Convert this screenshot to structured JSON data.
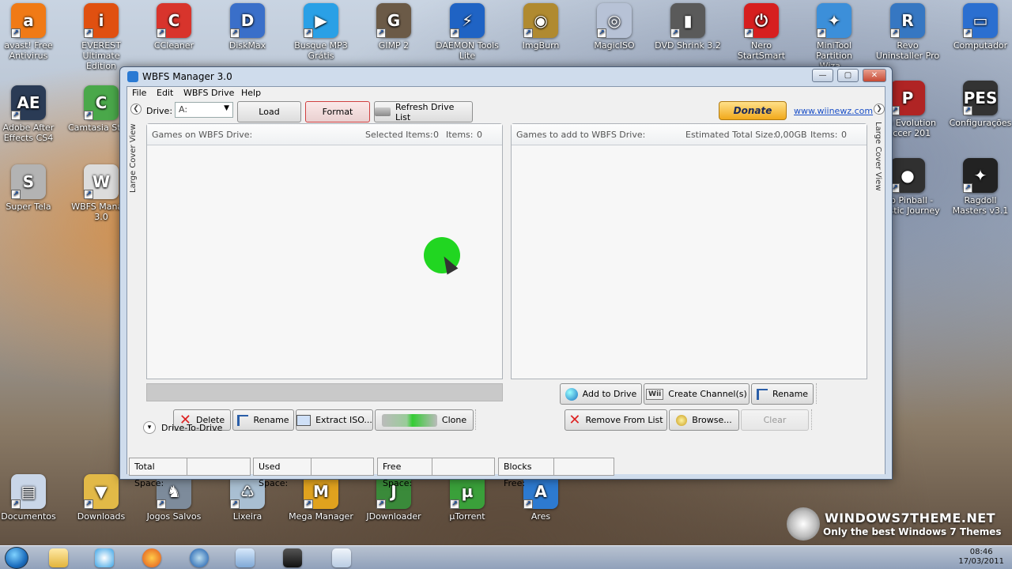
{
  "desktop": {
    "top_icons": [
      {
        "label": "avast! Free Antivirus",
        "color": "#f07a16",
        "glyph": "a"
      },
      {
        "label": "EVEREST Ultimate Edition",
        "color": "#e05010",
        "glyph": "i"
      },
      {
        "label": "CCleaner",
        "color": "#d8342c",
        "glyph": "C"
      },
      {
        "label": "DiskMax",
        "color": "#3a6fc9",
        "glyph": "D"
      },
      {
        "label": "Busque MP3 Grátis",
        "color": "#2aa0e6",
        "glyph": "▶"
      },
      {
        "label": "GIMP 2",
        "color": "#6b5a47",
        "glyph": "G"
      },
      {
        "label": "DAEMON Tools Lite",
        "color": "#1f63c4",
        "glyph": "⚡"
      },
      {
        "label": "ImgBurn",
        "color": "#b08a30",
        "glyph": "◉"
      },
      {
        "label": "MagicISO",
        "color": "#b7c2d6",
        "glyph": "◎"
      },
      {
        "label": "DVD Shrink 3.2",
        "color": "#5a5a5a",
        "glyph": "▮"
      },
      {
        "label": "Nero StartSmart",
        "color": "#d61f1f",
        "glyph": "⏻"
      },
      {
        "label": "MiniTool Partition Wiza...",
        "color": "#3c8fd9",
        "glyph": "✦"
      },
      {
        "label": "Revo Uninstaller Pro",
        "color": "#3677c2",
        "glyph": "R"
      },
      {
        "label": "Computador",
        "color": "#2b6fd0",
        "glyph": "▭"
      }
    ],
    "left_icons": [
      {
        "label": "Adobe After Effects CS4",
        "color": "#2a3b55",
        "glyph": "AE"
      },
      {
        "label": "Camtasia Stu...",
        "color": "#4aa84a",
        "glyph": "C"
      },
      {
        "label": "Super Tela",
        "color": "#b3b3b3",
        "glyph": "S"
      },
      {
        "label": "WBFS Mana... 3.0",
        "color": "#dcdcdc",
        "glyph": "W"
      }
    ],
    "right_icons": [
      {
        "label": "...o Evolution ...ccer 201",
        "color": "#b02424",
        "glyph": "P"
      },
      {
        "label": "Configurações",
        "color": "#333333",
        "glyph": "PES"
      },
      {
        "label": "...o Pinball - ...astic Journey",
        "color": "#303030",
        "glyph": "●"
      },
      {
        "label": "Ragdoll Masters v3.1",
        "color": "#222222",
        "glyph": "✦"
      }
    ],
    "bottom_icons": [
      {
        "label": "Documentos",
        "color": "#c9d6e8",
        "glyph": "▤"
      },
      {
        "label": "Downloads",
        "color": "#e2b947",
        "glyph": "▼"
      },
      {
        "label": "Jogos Salvos",
        "color": "#7d8b9b",
        "glyph": "♞"
      },
      {
        "label": "Lixeira",
        "color": "#a9bfd2",
        "glyph": "♺"
      },
      {
        "label": "Mega Manager",
        "color": "#e0a21e",
        "glyph": "M"
      },
      {
        "label": "JDownloader",
        "color": "#3a8a3a",
        "glyph": "J"
      },
      {
        "label": "µTorrent",
        "color": "#3aa03a",
        "glyph": "µ"
      },
      {
        "label": "Ares",
        "color": "#2d7ad0",
        "glyph": "A"
      }
    ],
    "watermark": {
      "title": "WINDOWS7THEME.NET",
      "subtitle": "Only the best Windows 7 Themes"
    }
  },
  "taskbar": {
    "time": "08:46",
    "date": "17/03/2011"
  },
  "window": {
    "title": "WBFS Manager 3.0",
    "controls": {
      "minimize": "—",
      "maximize": "▢",
      "close": "✕"
    },
    "menu": [
      "File",
      "Edit",
      "WBFS Drive",
      "Help"
    ],
    "toolbar": {
      "drive_label": "Drive:",
      "drive_value": "A:",
      "load": "Load",
      "format": "Format",
      "refresh": "Refresh Drive List",
      "donate": "Donate",
      "site": "www.wiinewz.com"
    },
    "left_panel": {
      "title": "Games on WBFS Drive:",
      "selected_label": "Selected Items:",
      "selected_value": "0",
      "items_label": "Items:",
      "items_value": "0",
      "side_label": "Large Cover View"
    },
    "right_panel": {
      "title": "Games to add to WBFS Drive:",
      "size_label": "Estimated Total Size:",
      "size_value": "0,00GB",
      "items_label": "Items:",
      "items_value": "0",
      "side_label": "Large Cover View"
    },
    "left_actions": {
      "delete": "Delete",
      "rename": "Rename",
      "extract": "Extract ISO...",
      "clone": "Clone"
    },
    "right_actions": {
      "add": "Add to Drive",
      "channel": "Create Channel(s)",
      "rename": "Rename",
      "remove": "Remove From List",
      "browse": "Browse...",
      "clear": "Clear"
    },
    "drive_to_drive": "Drive-To-Drive",
    "status": {
      "total": "Total Space:",
      "used": "Used Space:",
      "free": "Free Space:",
      "blocks": "Blocks Free:"
    }
  }
}
